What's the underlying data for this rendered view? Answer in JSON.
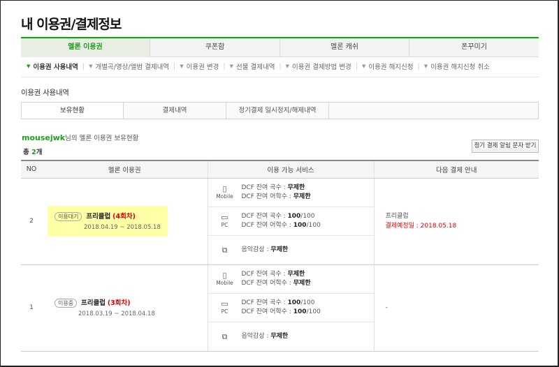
{
  "page_title": "내 이용권/결제정보",
  "main_tabs": [
    "멜론 이용권",
    "쿠폰함",
    "멜론 캐쉬",
    "폰꾸미기"
  ],
  "sub_nav": [
    "이용권 사용내역",
    "개별곡/영상/앨범 결제내역",
    "이용권 변경",
    "선물 결제내역",
    "이용권 결제방법 변경",
    "이용권 해지신청",
    "이용권 해지신청 취소"
  ],
  "section_title": "이용권 사용내역",
  "sub_tabs": [
    "보유현황",
    "결제내역",
    "정기결제 일시정지/해제내역",
    ""
  ],
  "owner": {
    "user": "mousejwk",
    "suffix": "님의 멜론 이용권 보유현황"
  },
  "count": {
    "prefix": "총 ",
    "num": "2",
    "suffix": "개"
  },
  "sms_button": "정기 결제 알림 문자 받기",
  "table": {
    "headers": [
      "NO",
      "멜론 이용권",
      "이용 가능 서비스",
      "다음 결제 안내"
    ],
    "rows": [
      {
        "no": "2",
        "status": "이용대기",
        "name": "프리클럽",
        "count": "(4회차)",
        "period": "2018.04.19 ~ 2018.05.18",
        "services": [
          {
            "device": "Mobile",
            "line1_label": "DCF 잔여 곡수 : ",
            "line1_value": "무제한",
            "line2_label": "DCF 잔여 어학수 : ",
            "line2_value": "무제한"
          },
          {
            "device": "PC",
            "line1_label": "DCF 잔여 곡수 : ",
            "line1_value": "100",
            "line1_rest": "/100",
            "line2_label": "DCF 잔여 어학수 : ",
            "line2_value": "100",
            "line2_rest": "/100"
          },
          {
            "device": "",
            "line1_label": "음악감상 : ",
            "line1_value": "무제한"
          }
        ],
        "next_name": "프리클럽",
        "next_date": "결제예정일 : 2018.05.18"
      },
      {
        "no": "1",
        "status": "이용중",
        "name": "프리클럽",
        "count": "(3회차)",
        "period": "2018.03.19 ~ 2018.04.18",
        "services": [
          {
            "device": "Mobile",
            "line1_label": "DCF 잔여 곡수 : ",
            "line1_value": "무제한",
            "line2_label": "DCF 잔여 어학수 : ",
            "line2_value": "무제한"
          },
          {
            "device": "PC",
            "line1_label": "DCF 잔여 곡수 : ",
            "line1_value": "100",
            "line1_rest": "/100",
            "line2_label": "DCF 잔여 어학수 : ",
            "line2_value": "100",
            "line2_rest": "/100"
          },
          {
            "device": "",
            "line1_label": "음악감상 : ",
            "line1_value": "무제한"
          }
        ],
        "next_name": "-",
        "next_date": ""
      }
    ]
  }
}
